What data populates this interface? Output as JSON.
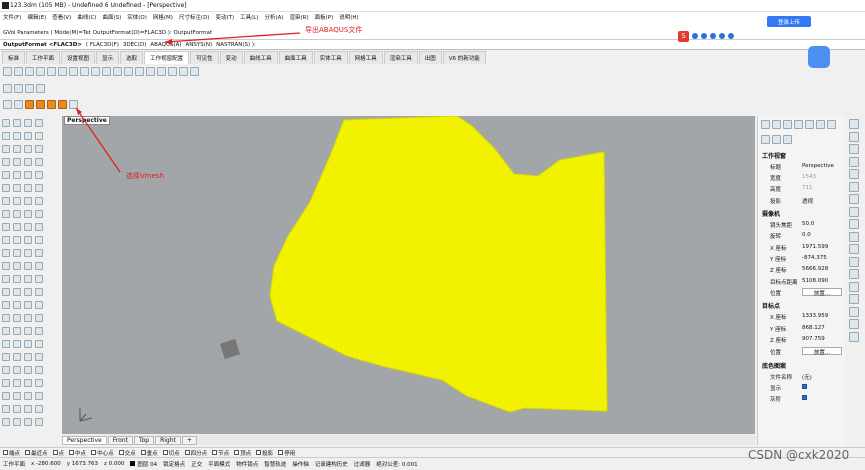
{
  "window": {
    "title": "123.3dm (105 MB) - Undefined 6 Undefined - [Perspective]"
  },
  "menu": [
    "文件(F)",
    "编辑(E)",
    "查看(V)",
    "曲线(C)",
    "曲面(S)",
    "实体(O)",
    "网格(M)",
    "尺寸标注(D)",
    "变动(T)",
    "工具(L)",
    "分析(A)",
    "渲染(R)",
    "面板(P)",
    "说明(H)"
  ],
  "command": {
    "history": "GVol Parameters ( Mode(M)=Tet  OutputFormat(O)=FLAC3D ): OutputFormat",
    "prompt": "OutputFormat <FLAC3D>",
    "options": [
      "( FLAC3D(F)",
      "3DEC(D)",
      "ABAQUS(A)",
      "ANSYS(N)",
      "NASTRAN(S) ):"
    ]
  },
  "tabs": [
    "标准",
    "工作平面",
    "设置视图",
    "显示",
    "选取",
    "工作视窗配置",
    "可见性",
    "变动",
    "曲线工具",
    "曲面工具",
    "实体工具",
    "网格工具",
    "渲染工具",
    "出图",
    "V6 的新功能"
  ],
  "active_tab": "工作视窗配置",
  "annotations": {
    "export": "导出ABAQUS文件",
    "vmesh": "选择Vmesh"
  },
  "viewport": {
    "label": "Perspective",
    "mesh_color": "#f4f400"
  },
  "viewtabs": [
    "Perspective",
    "Front",
    "Top",
    "Right",
    "+"
  ],
  "osnap": [
    {
      "label": "端点",
      "checked": false
    },
    {
      "label": "最近点",
      "checked": false
    },
    {
      "label": "点",
      "checked": false
    },
    {
      "label": "中点",
      "checked": false
    },
    {
      "label": "中心点",
      "checked": false
    },
    {
      "label": "交点",
      "checked": false
    },
    {
      "label": "垂点",
      "checked": false
    },
    {
      "label": "切点",
      "checked": false
    },
    {
      "label": "四分点",
      "checked": false
    },
    {
      "label": "节点",
      "checked": false
    },
    {
      "label": "顶点",
      "checked": false
    },
    {
      "label": "投影",
      "checked": false
    },
    {
      "label": "停用",
      "checked": false
    }
  ],
  "status": {
    "cplane": "工作平面",
    "x": "x -280.600",
    "y": "y 1673.763",
    "z": "z 0.000",
    "layer": "图层 04",
    "items": [
      "锁定格点",
      "正交",
      "平面模式",
      "物件锁点",
      "智慧轨迹",
      "操作轴",
      "记录建构历史",
      "过滤器",
      "绝对公差: 0.001"
    ]
  },
  "panel": {
    "viewport_title": "工作视窗",
    "title_label": "标题",
    "title_value": "Perspective",
    "width_label": "宽度",
    "width_value": "1543",
    "height_label": "高度",
    "height_value": "711",
    "projection_label": "投影",
    "projection_value": "透视",
    "camera_title": "摄像机",
    "lens_label": "镜头焦距",
    "lens_value": "50.0",
    "rotate_label": "旋转",
    "rotate_value": "0.0",
    "cx_label": "X 座标",
    "cx_value": "1971.599",
    "cy_label": "Y 座标",
    "cy_value": "-874.375",
    "cz_label": "Z 座标",
    "cz_value": "5666.928",
    "dist_label": "目标点距离",
    "dist_value": "5108.090",
    "pos_label": "位置",
    "pos_button": "放置...",
    "target_title": "目标点",
    "tx_label": "X 座标",
    "tx_value": "1333.959",
    "ty_label": "Y 座标",
    "ty_value": "868.127",
    "tz_label": "Z 座标",
    "tz_value": "907.759",
    "tpos_label": "位置",
    "tpos_button": "放置...",
    "bg_title": "底色图案",
    "file_label": "文件名称",
    "file_value": "(无)",
    "show_label": "显示",
    "gray_label": "灰阶"
  },
  "cloud_button": "登录上传",
  "watermark": "CSDN @cxk2020"
}
